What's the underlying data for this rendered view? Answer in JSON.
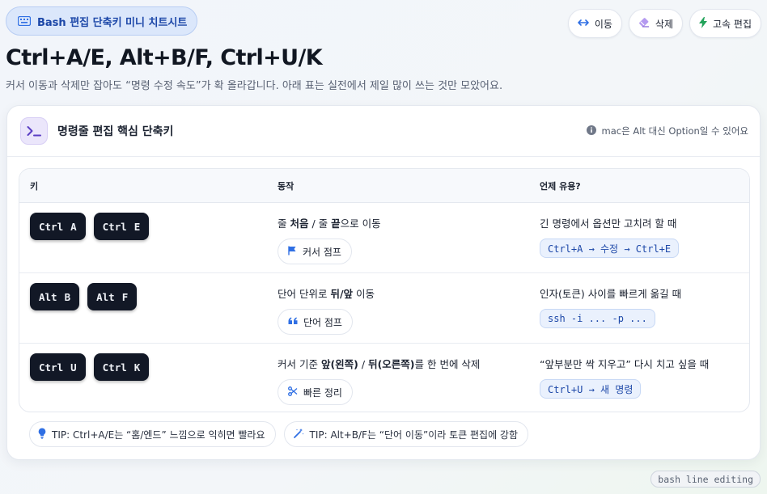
{
  "top_badge": {
    "label": "Bash 편집 단축키 미니 치트시트",
    "icon": "keyboard-icon"
  },
  "actions": [
    {
      "label": "이동",
      "icon": "arrows-horizontal-icon"
    },
    {
      "label": "삭제",
      "icon": "eraser-icon"
    },
    {
      "label": "고속 편집",
      "icon": "lightning-icon"
    }
  ],
  "headline": "Ctrl+A/E, Alt+B/F, Ctrl+U/K",
  "subtitle": "커서 이동과 삭제만 잡아도 “명령 수정 속도”가 확 올라갑니다. 아래 표는 실전에서 제일 많이 쓰는 것만 모았어요.",
  "card": {
    "icon": "terminal-icon",
    "title": "명령줄 편집 핵심 단축키",
    "note": "mac은 Alt 대신 Option일 수 있어요",
    "note_icon": "info-icon"
  },
  "table": {
    "headers": [
      "키",
      "동작",
      "언제 유용?"
    ],
    "rows": [
      {
        "keys": [
          {
            "mod": "Ctrl",
            "key": "A"
          },
          {
            "mod": "Ctrl",
            "key": "E"
          }
        ],
        "desc": {
          "pre": "줄 ",
          "b1": "처음",
          "mid": " / 줄 ",
          "b2": "끝",
          "post": "으로 이동"
        },
        "chip": {
          "label": "커서 점프",
          "icon": "flag-icon"
        },
        "when": "긴 명령에서 옵션만 고치려 할 때",
        "code": "Ctrl+A → 수정 → Ctrl+E"
      },
      {
        "keys": [
          {
            "mod": "Alt",
            "key": "B"
          },
          {
            "mod": "Alt",
            "key": "F"
          }
        ],
        "desc": {
          "pre": "단어 단위로 ",
          "b1": "뒤/앞",
          "mid": " 이동",
          "b2": "",
          "post": ""
        },
        "chip": {
          "label": "단어 점프",
          "icon": "quote-icon"
        },
        "when": "인자(토큰) 사이를 빠르게 옮길 때",
        "code": "ssh -i ... -p ..."
      },
      {
        "keys": [
          {
            "mod": "Ctrl",
            "key": "U"
          },
          {
            "mod": "Ctrl",
            "key": "K"
          }
        ],
        "desc": {
          "pre": "커서 기준 ",
          "b1": "앞(왼쪽)",
          "mid": " / ",
          "b2": "뒤(오른쪽)",
          "post": "를 한 번에 삭제"
        },
        "chip": {
          "label": "빠른 정리",
          "icon": "scissors-icon"
        },
        "when": "“앞부분만 싹 지우고” 다시 치고 싶을 때",
        "code": "Ctrl+U → 새 명령"
      }
    ]
  },
  "tips": [
    {
      "label": "TIP: Ctrl+A/E는 “홈/엔드” 느낌으로 익히면 빨라요",
      "icon": "lightbulb-icon"
    },
    {
      "label": "TIP: Alt+B/F는 “단어 이동”이라 토큰 편집에 강함",
      "icon": "magic-wand-icon"
    }
  ],
  "footer_tag": "bash line editing",
  "colors": {
    "accent": "#2f6fe4",
    "key_bg": "#121826",
    "badge_bg": "#dbe7fb",
    "code_bg": "#eaf1fd"
  }
}
